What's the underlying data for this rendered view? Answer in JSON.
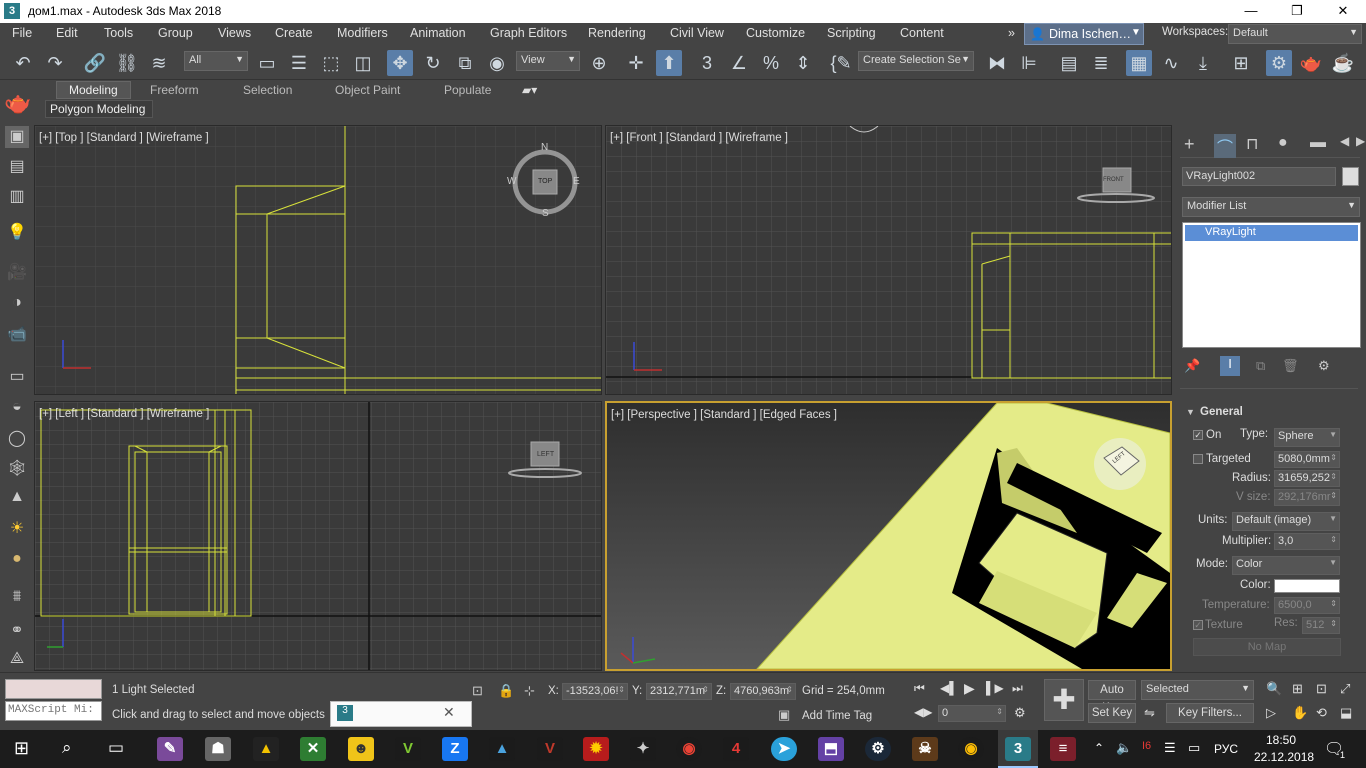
{
  "window": {
    "title": "дом1.max - Autodesk 3ds Max 2018",
    "app_icon": "3",
    "minimize": "—",
    "maximize": "❐",
    "close": "✕"
  },
  "menu": {
    "items": [
      "File",
      "Edit",
      "Tools",
      "Group",
      "Views",
      "Create",
      "Modifiers",
      "Animation",
      "Graph Editors",
      "Rendering",
      "Civil View",
      "Customize",
      "Scripting",
      "Content"
    ],
    "overflow": "»",
    "user": "Dima Ischen…",
    "workspaces_label": "Workspaces:",
    "workspace_value": "Default"
  },
  "toolbar": {
    "filter_value": "All",
    "refcoord_value": "View",
    "selection_set_value": "Create Selection Se"
  },
  "ribbon": {
    "tabs": [
      "Modeling",
      "Freeform",
      "Selection",
      "Object Paint",
      "Populate"
    ],
    "active_tab": "Modeling",
    "sub_label": "Polygon Modeling"
  },
  "viewports": {
    "top": {
      "label": "[+] [Top ] [Standard ] [Wireframe ]",
      "cube": "TOP",
      "compass": [
        "N",
        "E",
        "S",
        "W"
      ]
    },
    "front": {
      "label": "[+] [Front ] [Standard ] [Wireframe ]",
      "cube": "FRONT"
    },
    "left": {
      "label": "[+] [Left ] [Standard ] [Wireframe ]",
      "cube": "LEFT"
    },
    "perspective": {
      "label": "[+] [Perspective ] [Standard ] [Edged Faces ]",
      "cube": "LEFT"
    }
  },
  "panel": {
    "object_name": "VRayLight002",
    "modifier_list": "Modifier List",
    "stack_item": "VRayLight",
    "rollout_title": "General",
    "on_label": "On",
    "type_label": "Type:",
    "type_value": "Sphere",
    "targeted_label": "Targeted",
    "targeted_value": "5080,0mm",
    "radius_label": "Radius:",
    "radius_value": "31659,252",
    "vsize_label": "V size:",
    "vsize_value": "292,176mr",
    "units_label": "Units:",
    "units_value": "Default (image)",
    "multiplier_label": "Multiplier:",
    "multiplier_value": "3,0",
    "mode_label": "Mode:",
    "mode_value": "Color",
    "color_label": "Color:",
    "temperature_label": "Temperature:",
    "temperature_value": "6500,0",
    "texture_label": "Texture",
    "res_label": "Res:",
    "res_value": "512",
    "nomap": "No Map"
  },
  "status": {
    "maxscript": "MAXScript Mi:",
    "selected_text": "1 Light Selected",
    "prompt": "Click and drag to select and move objects",
    "x_label": "X:",
    "x_value": "-13523,06!",
    "y_label": "Y:",
    "y_value": "2312,771m",
    "z_label": "Z:",
    "z_value": "4760,963m",
    "grid": "Grid = 254,0mm",
    "add_time_tag": "Add Time Tag",
    "frame_value": "0",
    "auto_key": "Auto Key",
    "set_key": "Set Key",
    "selected_dropdown": "Selected",
    "key_filters": "Key Filters..."
  },
  "taskbar": {
    "lang": "РУС",
    "time": "18:50",
    "date": "22.12.2018",
    "notif_count": "1"
  },
  "colors": {
    "wire": "#d8e23a",
    "face": "#e4eb88",
    "accent": "#5a7ea8"
  }
}
